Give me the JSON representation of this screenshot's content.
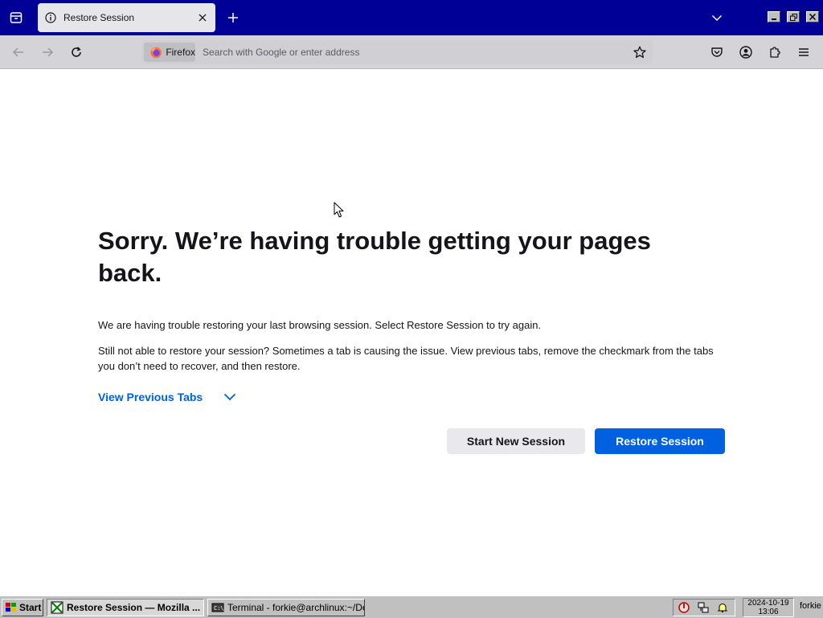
{
  "window": {
    "tab_title": "Restore Session"
  },
  "navbar": {
    "identity_label": "Firefox",
    "url_placeholder": "Search with Google or enter address"
  },
  "page": {
    "title": "Sorry. We’re having trouble getting your pages back.",
    "paragraph1": "We are having trouble restoring your last browsing session. Select Restore Session to try again.",
    "paragraph2": "Still not able to restore your session? Sometimes a tab is causing the issue. View previous tabs, remove the checkmark from the tabs you don’t need to recover, and then restore.",
    "view_previous_tabs": "View Previous Tabs",
    "start_new_session": "Start New Session",
    "restore_session": "Restore Session"
  },
  "taskbar": {
    "start_label": "Start",
    "tasks": [
      {
        "label": "Restore Session — Mozilla ...",
        "icon": "firefox-window-icon",
        "active": true
      },
      {
        "label": "Terminal - forkie@archlinux:~/De...",
        "icon": "terminal-icon",
        "active": false
      }
    ],
    "clock_date": "2024-10-19",
    "clock_time": "13:06",
    "user": "forkie"
  },
  "colors": {
    "titlebar": "#000096",
    "accent": "#0061e0",
    "taskbar": "#c0c0c0"
  }
}
